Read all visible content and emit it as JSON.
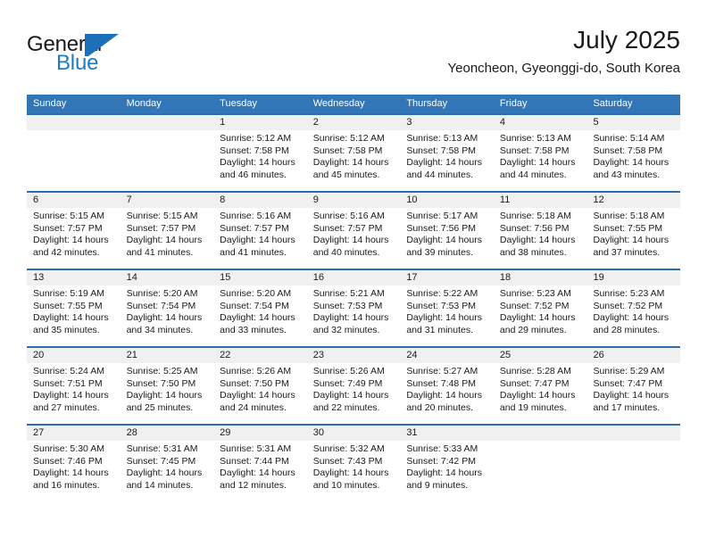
{
  "brand": {
    "name_part1": "General",
    "name_part2": "Blue",
    "mark": "blue-triangle-logo"
  },
  "header": {
    "title": "July 2025",
    "subtitle": "Yeoncheon, Gyeonggi-do, South Korea"
  },
  "colors": {
    "header_blue": "#3276b8",
    "separator_blue": "#2f6da8",
    "daynum_band": "#f0f0f0",
    "brand_blue": "#1d7cc4",
    "text": "#1a1a1a"
  },
  "weekdays": [
    "Sunday",
    "Monday",
    "Tuesday",
    "Wednesday",
    "Thursday",
    "Friday",
    "Saturday"
  ],
  "weeks": [
    [
      {
        "day": "",
        "sunrise": "",
        "sunset": "",
        "daylight": ""
      },
      {
        "day": "",
        "sunrise": "",
        "sunset": "",
        "daylight": ""
      },
      {
        "day": "1",
        "sunrise": "Sunrise: 5:12 AM",
        "sunset": "Sunset: 7:58 PM",
        "daylight": "Daylight: 14 hours and 46 minutes."
      },
      {
        "day": "2",
        "sunrise": "Sunrise: 5:12 AM",
        "sunset": "Sunset: 7:58 PM",
        "daylight": "Daylight: 14 hours and 45 minutes."
      },
      {
        "day": "3",
        "sunrise": "Sunrise: 5:13 AM",
        "sunset": "Sunset: 7:58 PM",
        "daylight": "Daylight: 14 hours and 44 minutes."
      },
      {
        "day": "4",
        "sunrise": "Sunrise: 5:13 AM",
        "sunset": "Sunset: 7:58 PM",
        "daylight": "Daylight: 14 hours and 44 minutes."
      },
      {
        "day": "5",
        "sunrise": "Sunrise: 5:14 AM",
        "sunset": "Sunset: 7:58 PM",
        "daylight": "Daylight: 14 hours and 43 minutes."
      }
    ],
    [
      {
        "day": "6",
        "sunrise": "Sunrise: 5:15 AM",
        "sunset": "Sunset: 7:57 PM",
        "daylight": "Daylight: 14 hours and 42 minutes."
      },
      {
        "day": "7",
        "sunrise": "Sunrise: 5:15 AM",
        "sunset": "Sunset: 7:57 PM",
        "daylight": "Daylight: 14 hours and 41 minutes."
      },
      {
        "day": "8",
        "sunrise": "Sunrise: 5:16 AM",
        "sunset": "Sunset: 7:57 PM",
        "daylight": "Daylight: 14 hours and 41 minutes."
      },
      {
        "day": "9",
        "sunrise": "Sunrise: 5:16 AM",
        "sunset": "Sunset: 7:57 PM",
        "daylight": "Daylight: 14 hours and 40 minutes."
      },
      {
        "day": "10",
        "sunrise": "Sunrise: 5:17 AM",
        "sunset": "Sunset: 7:56 PM",
        "daylight": "Daylight: 14 hours and 39 minutes."
      },
      {
        "day": "11",
        "sunrise": "Sunrise: 5:18 AM",
        "sunset": "Sunset: 7:56 PM",
        "daylight": "Daylight: 14 hours and 38 minutes."
      },
      {
        "day": "12",
        "sunrise": "Sunrise: 5:18 AM",
        "sunset": "Sunset: 7:55 PM",
        "daylight": "Daylight: 14 hours and 37 minutes."
      }
    ],
    [
      {
        "day": "13",
        "sunrise": "Sunrise: 5:19 AM",
        "sunset": "Sunset: 7:55 PM",
        "daylight": "Daylight: 14 hours and 35 minutes."
      },
      {
        "day": "14",
        "sunrise": "Sunrise: 5:20 AM",
        "sunset": "Sunset: 7:54 PM",
        "daylight": "Daylight: 14 hours and 34 minutes."
      },
      {
        "day": "15",
        "sunrise": "Sunrise: 5:20 AM",
        "sunset": "Sunset: 7:54 PM",
        "daylight": "Daylight: 14 hours and 33 minutes."
      },
      {
        "day": "16",
        "sunrise": "Sunrise: 5:21 AM",
        "sunset": "Sunset: 7:53 PM",
        "daylight": "Daylight: 14 hours and 32 minutes."
      },
      {
        "day": "17",
        "sunrise": "Sunrise: 5:22 AM",
        "sunset": "Sunset: 7:53 PM",
        "daylight": "Daylight: 14 hours and 31 minutes."
      },
      {
        "day": "18",
        "sunrise": "Sunrise: 5:23 AM",
        "sunset": "Sunset: 7:52 PM",
        "daylight": "Daylight: 14 hours and 29 minutes."
      },
      {
        "day": "19",
        "sunrise": "Sunrise: 5:23 AM",
        "sunset": "Sunset: 7:52 PM",
        "daylight": "Daylight: 14 hours and 28 minutes."
      }
    ],
    [
      {
        "day": "20",
        "sunrise": "Sunrise: 5:24 AM",
        "sunset": "Sunset: 7:51 PM",
        "daylight": "Daylight: 14 hours and 27 minutes."
      },
      {
        "day": "21",
        "sunrise": "Sunrise: 5:25 AM",
        "sunset": "Sunset: 7:50 PM",
        "daylight": "Daylight: 14 hours and 25 minutes."
      },
      {
        "day": "22",
        "sunrise": "Sunrise: 5:26 AM",
        "sunset": "Sunset: 7:50 PM",
        "daylight": "Daylight: 14 hours and 24 minutes."
      },
      {
        "day": "23",
        "sunrise": "Sunrise: 5:26 AM",
        "sunset": "Sunset: 7:49 PM",
        "daylight": "Daylight: 14 hours and 22 minutes."
      },
      {
        "day": "24",
        "sunrise": "Sunrise: 5:27 AM",
        "sunset": "Sunset: 7:48 PM",
        "daylight": "Daylight: 14 hours and 20 minutes."
      },
      {
        "day": "25",
        "sunrise": "Sunrise: 5:28 AM",
        "sunset": "Sunset: 7:47 PM",
        "daylight": "Daylight: 14 hours and 19 minutes."
      },
      {
        "day": "26",
        "sunrise": "Sunrise: 5:29 AM",
        "sunset": "Sunset: 7:47 PM",
        "daylight": "Daylight: 14 hours and 17 minutes."
      }
    ],
    [
      {
        "day": "27",
        "sunrise": "Sunrise: 5:30 AM",
        "sunset": "Sunset: 7:46 PM",
        "daylight": "Daylight: 14 hours and 16 minutes."
      },
      {
        "day": "28",
        "sunrise": "Sunrise: 5:31 AM",
        "sunset": "Sunset: 7:45 PM",
        "daylight": "Daylight: 14 hours and 14 minutes."
      },
      {
        "day": "29",
        "sunrise": "Sunrise: 5:31 AM",
        "sunset": "Sunset: 7:44 PM",
        "daylight": "Daylight: 14 hours and 12 minutes."
      },
      {
        "day": "30",
        "sunrise": "Sunrise: 5:32 AM",
        "sunset": "Sunset: 7:43 PM",
        "daylight": "Daylight: 14 hours and 10 minutes."
      },
      {
        "day": "31",
        "sunrise": "Sunrise: 5:33 AM",
        "sunset": "Sunset: 7:42 PM",
        "daylight": "Daylight: 14 hours and 9 minutes."
      },
      {
        "day": "",
        "sunrise": "",
        "sunset": "",
        "daylight": ""
      },
      {
        "day": "",
        "sunrise": "",
        "sunset": "",
        "daylight": ""
      }
    ]
  ]
}
